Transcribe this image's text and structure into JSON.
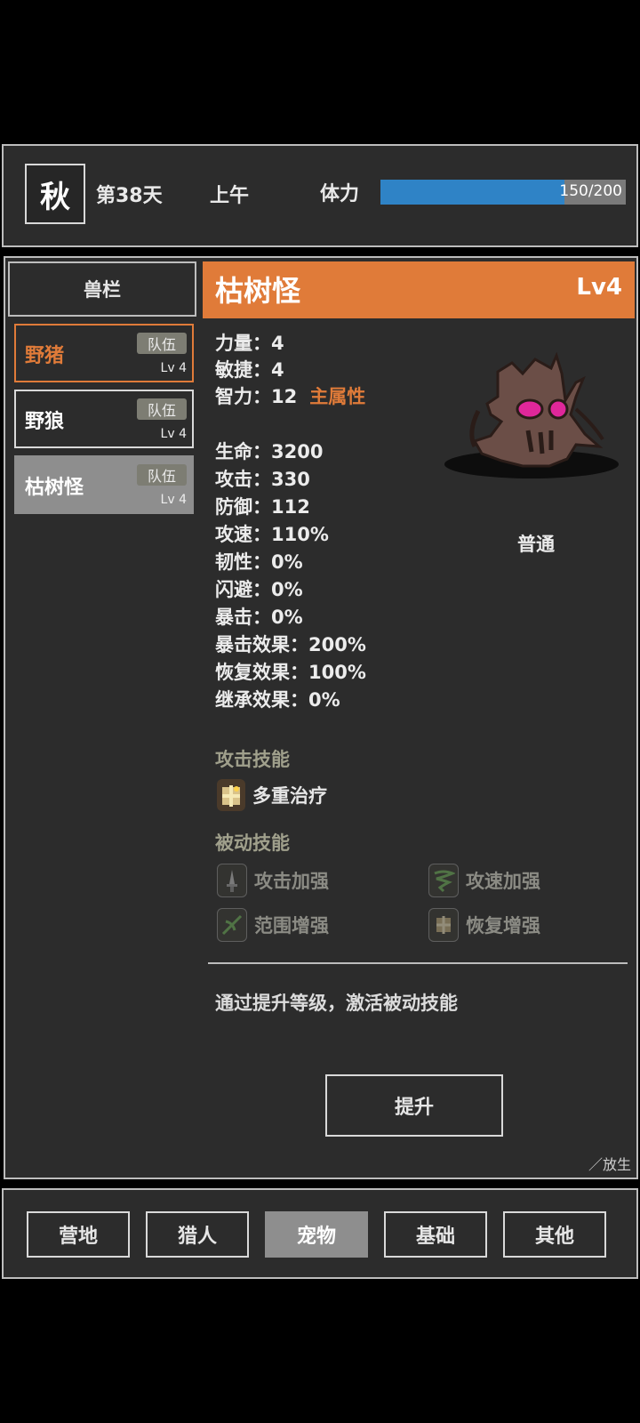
{
  "header": {
    "season": "秋",
    "day": "第38天",
    "time_of_day": "上午",
    "stamina_label": "体力",
    "stamina_text": "150/200",
    "stamina_fraction": 0.75
  },
  "left_panel": {
    "title": "兽栏",
    "pets": [
      {
        "name": "野猪",
        "badge": "队伍",
        "level": "Lv 4",
        "state": "orange"
      },
      {
        "name": "野狼",
        "badge": "队伍",
        "level": "Lv 4",
        "state": "normal"
      },
      {
        "name": "枯树怪",
        "badge": "队伍",
        "level": "Lv 4",
        "state": "selected"
      }
    ]
  },
  "detail": {
    "name": "枯树怪",
    "level": "Lv4",
    "primary_stats": [
      {
        "label": "力量：4"
      },
      {
        "label": "敏捷：4"
      },
      {
        "label": "智力：12",
        "tag": "主属性"
      }
    ],
    "stats": [
      "生命：3200",
      "攻击：330",
      "防御：112",
      "攻速：110%",
      "韧性：0%",
      "闪避：0%",
      "暴击：0%",
      "暴击效果：200%",
      "恢复效果：100%",
      "继承效果：0%"
    ],
    "attack_type": "普通",
    "attack_skills_title": "攻击技能",
    "attack_skill": "多重治疗",
    "passive_skills_title": "被动技能",
    "passive_skills": [
      "攻击加强",
      "攻速加强",
      "范围增强",
      "恢复增强"
    ],
    "hint": "通过提升等级，激活被动技能",
    "upgrade_button": "提升",
    "release_link": "／放生"
  },
  "bottom_nav": {
    "tabs": [
      "营地",
      "猎人",
      "宠物",
      "基础",
      "其他"
    ],
    "active_index": 2
  },
  "colors": {
    "accent": "#e07b39",
    "stamina": "#2f83c6",
    "panel": "#2c2c2c",
    "border": "#bdbdbd"
  }
}
